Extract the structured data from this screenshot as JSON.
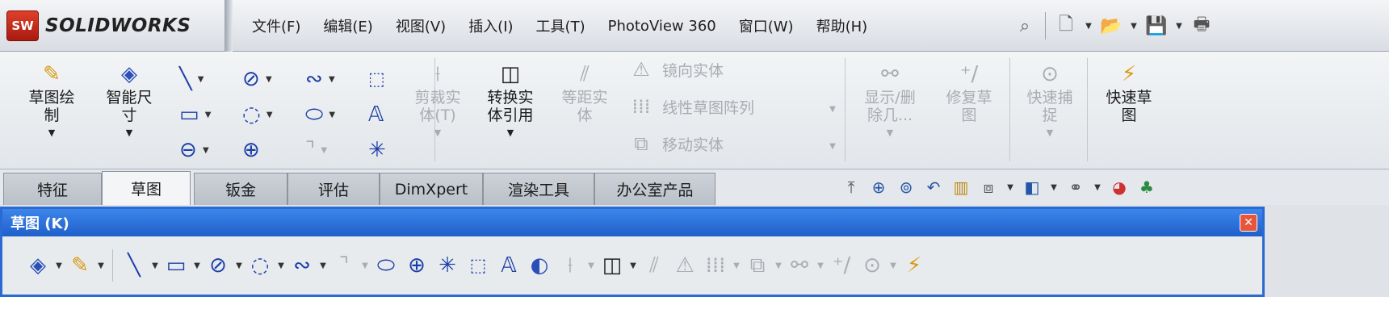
{
  "app": {
    "logo_badge": "SW",
    "logo_text": "SOLIDWORKS"
  },
  "menu": [
    "文件(F)",
    "编辑(E)",
    "视图(V)",
    "插入(I)",
    "工具(T)",
    "PhotoView 360",
    "窗口(W)",
    "帮助(H)"
  ],
  "quick_access": [
    {
      "name": "pushpin-icon",
      "glyph": "⌕"
    },
    {
      "name": "new-document-icon",
      "glyph": "🗋"
    },
    {
      "name": "open-folder-icon",
      "glyph": "📂"
    },
    {
      "name": "save-icon",
      "glyph": "💾"
    },
    {
      "name": "print-icon",
      "glyph": "🖶"
    }
  ],
  "command_manager": {
    "sketch": {
      "label": "草图绘\n制",
      "icon": "✎"
    },
    "smart_dimension": {
      "label": "智能尺\n寸",
      "icon": "◈"
    },
    "trim": {
      "label": "剪裁实\n体(T)",
      "icon": "⟊"
    },
    "convert": {
      "label": "转换实\n体引用",
      "icon": "◫"
    },
    "offset": {
      "label": "等距实\n体",
      "icon": "⫽"
    },
    "mirror": {
      "label": "镜向实体",
      "icon": "⚠"
    },
    "linear_pattern": {
      "label": "线性草图阵列",
      "icon": "⁞⁞⁞"
    },
    "move": {
      "label": "移动实体",
      "icon": "⧉"
    },
    "display_delete": {
      "label": "显示/删\n除几...",
      "icon": "⚯"
    },
    "repair": {
      "label": "修复草\n图",
      "icon": "⁺∕"
    },
    "quick_snaps": {
      "label": "快速捕\n捉",
      "icon": "⊙"
    },
    "rapid_sketch": {
      "label": "快速草\n图",
      "icon": "⚡"
    }
  },
  "tabs": [
    "特征",
    "草图",
    "钣金",
    "评估",
    "DimXpert",
    "渲染工具",
    "办公室产品"
  ],
  "active_tab": "草图",
  "toolbar_window": {
    "title": "草图 (K)",
    "close": "✕"
  },
  "colors": {
    "titlebar": "#2a6ad2",
    "accent_red": "#d0301c",
    "disabled": "#a9adb2"
  }
}
